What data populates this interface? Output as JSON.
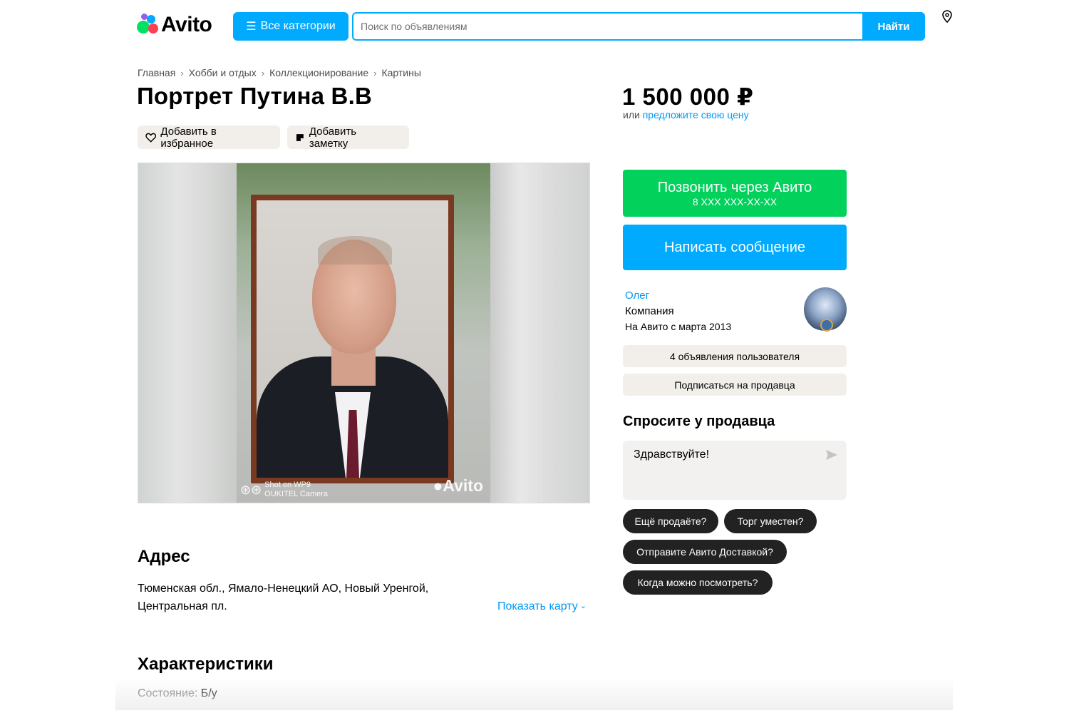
{
  "header": {
    "logo_text": "Avito",
    "categories_button": "Все категории",
    "search_placeholder": "Поиск по объявлениям",
    "search_button": "Найти",
    "location_icon": "map-pin-icon"
  },
  "breadcrumb": [
    "Главная",
    "Хобби и отдых",
    "Коллекционирование",
    "Картины"
  ],
  "listing": {
    "title": "Портрет Путина В.В",
    "favorite_label": "Добавить в избранное",
    "note_label": "Добавить заметку",
    "photo_watermark_line1": "Shot on WP9",
    "photo_watermark_line2": "OUKITEL Camera",
    "photo_watermark_brand": "Avito"
  },
  "address": {
    "title": "Адрес",
    "line1": "Тюменская обл., Ямало-Ненецкий АО, Новый Уренгой,",
    "line2": "Центральная пл.",
    "show_map": "Показать карту"
  },
  "characteristics": {
    "title": "Характеристики",
    "condition_key": "Состояние:",
    "condition_value": "Б/у"
  },
  "sidebar": {
    "price": "1 500 000 ₽",
    "offer_prefix": "или",
    "offer_link": "предложите свою цену",
    "call_label": "Позвонить через Авито",
    "call_phone": "8 XXX XXX-XX-XX",
    "message_label": "Написать сообщение",
    "seller_name": "Олег",
    "seller_type": "Компания",
    "seller_since": "На Авито с марта 2013",
    "seller_ads": "4 объявления пользователя",
    "subscribe": "Подписаться на продавца",
    "ask_title": "Спросите у продавца",
    "ask_text": "Здравствуйте!",
    "chips": [
      "Ещё продаёте?",
      "Торг уместен?",
      "Отправите Авито Доставкой?",
      "Когда можно посмотреть?"
    ]
  },
  "colors": {
    "accent_blue": "#00aaff",
    "call_green": "#02d15c",
    "link_blue": "#0099f7",
    "chip_dark": "#222222"
  }
}
